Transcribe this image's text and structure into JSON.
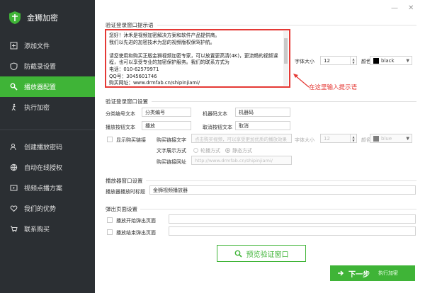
{
  "app": {
    "title": "金狮加密"
  },
  "window": {
    "minimize": "—",
    "close": "✕"
  },
  "sidebar": {
    "items": [
      {
        "label": "添加文件",
        "icon": "add-file-icon"
      },
      {
        "label": "防截录设置",
        "icon": "shield-icon"
      },
      {
        "label": "播放器配置",
        "icon": "wrench-icon",
        "active": true
      },
      {
        "label": "执行加密",
        "icon": "run-icon"
      },
      {
        "label": "创建播放密码",
        "icon": "user-key-icon"
      },
      {
        "label": "自动在线授权",
        "icon": "globe-icon"
      },
      {
        "label": "视频点播方案",
        "icon": "video-icon"
      },
      {
        "label": "我们的优势",
        "icon": "heart-icon"
      },
      {
        "label": "联系购买",
        "icon": "cart-icon"
      }
    ]
  },
  "prompt_section": {
    "title": "验证登录窗口提示语",
    "text": "您好！沐禾是视频加密解决方案和软件产品提供商。\n我们以先进的加密技术为您的视频版权保驾护航。\n\n请您使用和购买正版金狮视频加密专家，可以放置更高清(4K)，更流畅的视频课程，也可以享受专业的加密保护服务。我们的联系方式为\n电话：010-62579971\nQQ号：3045601746\n购买网址：www.drmfab.cn/shipinjiami/",
    "font_size_label": "字体大小",
    "font_size": "12",
    "color_label": "颜色",
    "color_value": "black",
    "color_hex": "#000000",
    "annotation": "在这里输入提示语"
  },
  "dialog_section": {
    "title": "验证登录窗口设置",
    "fields": {
      "group_label": "分类编号文本",
      "group_value": "分类编号",
      "machine_label": "机器码文本",
      "machine_value": "机器码",
      "play_label": "播放按钮文本",
      "play_value": "播放",
      "cancel_label": "取消按钮文本",
      "cancel_value": "取消"
    },
    "show_buy_link": "显示购买链接",
    "buy_link_text_label": "购买链接文字",
    "buy_link_text_placeholder": "点击购买视频，可以享受更加优质的播放效果",
    "buy_font_size_label": "字体大小",
    "buy_font_size": "12",
    "buy_color_label": "颜色",
    "buy_color_value": "blue",
    "buy_color_hex": "#2f6fd6",
    "display_mode_label": "文字展示方式",
    "display_mode_scroll": "轮播方式",
    "display_mode_static": "静态方式",
    "buy_url_label": "购买链接网址",
    "buy_url_value": "http://www.drmfab.cn/shipinjiami/"
  },
  "player_section": {
    "title": "播放器窗口设置",
    "caption_label": "播放器播放时标题",
    "caption_value": "金狮视频播放器"
  },
  "popup_section": {
    "title": "弹出页面设置",
    "start_label": "播放开始弹出页面",
    "end_label": "播放结束弹出页面"
  },
  "buttons": {
    "preview": "预览验证窗口",
    "next": "下一步",
    "next_sub": "执行加密"
  }
}
